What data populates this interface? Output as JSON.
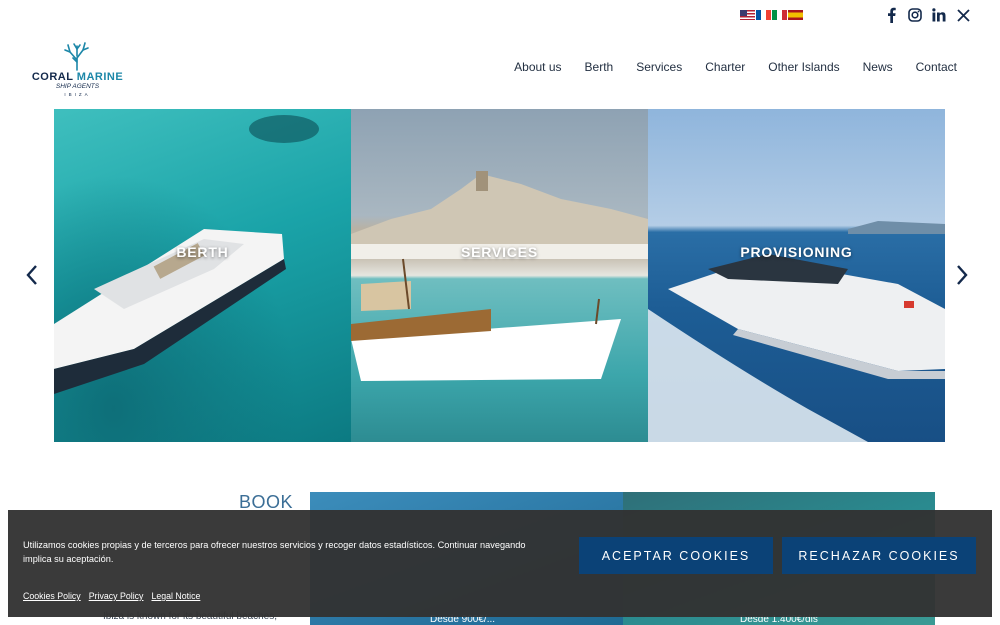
{
  "header": {
    "languages": [
      {
        "code": "en",
        "icon": "flag-uk-icon"
      },
      {
        "code": "fr",
        "icon": "flag-fr-icon"
      },
      {
        "code": "it",
        "icon": "flag-it-icon"
      },
      {
        "code": "es",
        "icon": "flag-es-icon"
      }
    ],
    "social": [
      "facebook-icon",
      "instagram-icon",
      "linkedin-icon",
      "x-icon"
    ],
    "logo": {
      "name_part1": "CORAL",
      "name_part2": "MARINE",
      "tagline": "SHIP AGENTS",
      "city": "IBIZA"
    },
    "nav": [
      {
        "label": "About us"
      },
      {
        "label": "Berth"
      },
      {
        "label": "Services"
      },
      {
        "label": "Charter"
      },
      {
        "label": "Other Islands"
      },
      {
        "label": "News"
      },
      {
        "label": "Contact"
      }
    ]
  },
  "slider": {
    "slides": [
      {
        "label": "BERTH"
      },
      {
        "label": "SERVICES"
      },
      {
        "label": "PROVISIONING"
      }
    ],
    "prev_icon": "chevron-left-icon",
    "next_icon": "chevron-right-icon"
  },
  "book": {
    "title": "BOOK",
    "desc_partial": "Ibiza is known for its beautiful beaches,",
    "price_1": "Desde 900€/...",
    "price_2": "Desde 1.400€/dis"
  },
  "cookies": {
    "text": "Utilizamos cookies propias y de terceros para ofrecer nuestros servicios y recoger datos estadísticos. Continuar navegando implica su aceptación.",
    "links": [
      {
        "label": "Cookies Policy"
      },
      {
        "label": "Privacy Policy"
      },
      {
        "label": "Legal Notice"
      }
    ],
    "accept_label": "ACEPTAR COOKIES",
    "reject_label": "RECHAZAR COOKIES"
  },
  "colors": {
    "brand_navy": "#13294b",
    "brand_teal": "#1c87a8",
    "button_blue": "#0b4277",
    "banner_bg": "#323232"
  }
}
